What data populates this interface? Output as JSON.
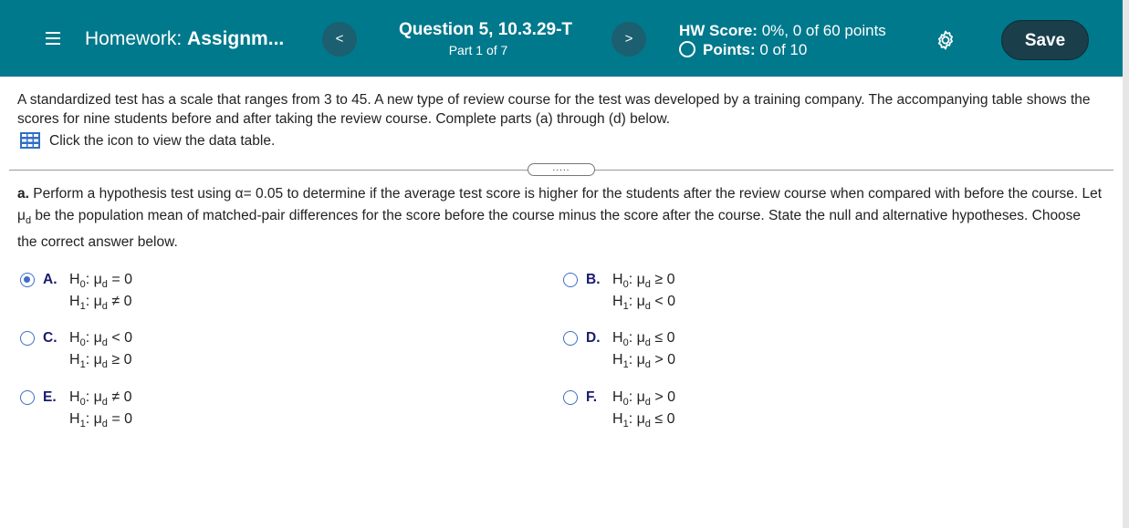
{
  "header": {
    "homework_prefix": "Homework:",
    "homework_name": "Assignm...",
    "prev_label": "<",
    "next_label": ">",
    "question_title": "Question 5, 10.3.29-T",
    "part": "Part 1 of 7",
    "hw_score_label": "HW Score:",
    "hw_score_value": "0%, 0 of 60 points",
    "points_label": "Points:",
    "points_value": "0 of 10",
    "save_label": "Save"
  },
  "intro": {
    "text": "A standardized test has a scale that ranges from 3 to 45. A new type of review course for the test was developed by a training company. The accompanying table shows the scores for nine students before and after taking the review course. Complete parts (a) through (d) below.",
    "table_link": "Click the icon to view the data table."
  },
  "divider": {
    "dots": "....."
  },
  "question": {
    "part_label": "a.",
    "text_1": "Perform a hypothesis test using",
    "alpha": "α",
    "alpha_value": "= 0.05",
    "text_2": "to determine if the average test score is higher for the students after the review course when compared with before the course. Let",
    "mu": "μ",
    "mu_sub": "d",
    "text_3": "be the population mean of matched-pair differences for the score before the course minus the score after the course. State the null and alternative hypotheses. Choose the correct answer below."
  },
  "options": [
    {
      "letter": "A.",
      "h0": "H",
      "h0_sub": "0",
      "h0_rel": ": μ",
      "h0_mu_sub": "d",
      "h0_tail": " = 0",
      "h1": "H",
      "h1_sub": "1",
      "h1_rel": ": μ",
      "h1_mu_sub": "d",
      "h1_tail": " ≠ 0",
      "selected": true
    },
    {
      "letter": "B.",
      "h0": "H",
      "h0_sub": "0",
      "h0_rel": ": μ",
      "h0_mu_sub": "d",
      "h0_tail": " ≥ 0",
      "h1": "H",
      "h1_sub": "1",
      "h1_rel": ": μ",
      "h1_mu_sub": "d",
      "h1_tail": " < 0",
      "selected": false
    },
    {
      "letter": "C.",
      "h0": "H",
      "h0_sub": "0",
      "h0_rel": ": μ",
      "h0_mu_sub": "d",
      "h0_tail": " < 0",
      "h1": "H",
      "h1_sub": "1",
      "h1_rel": ": μ",
      "h1_mu_sub": "d",
      "h1_tail": " ≥ 0",
      "selected": false
    },
    {
      "letter": "D.",
      "h0": "H",
      "h0_sub": "0",
      "h0_rel": ": μ",
      "h0_mu_sub": "d",
      "h0_tail": " ≤ 0",
      "h1": "H",
      "h1_sub": "1",
      "h1_rel": ": μ",
      "h1_mu_sub": "d",
      "h1_tail": " > 0",
      "selected": false
    },
    {
      "letter": "E.",
      "h0": "H",
      "h0_sub": "0",
      "h0_rel": ": μ",
      "h0_mu_sub": "d",
      "h0_tail": " ≠ 0",
      "h1": "H",
      "h1_sub": "1",
      "h1_rel": ": μ",
      "h1_mu_sub": "d",
      "h1_tail": " = 0",
      "selected": false
    },
    {
      "letter": "F.",
      "h0": "H",
      "h0_sub": "0",
      "h0_rel": ": μ",
      "h0_mu_sub": "d",
      "h0_tail": " > 0",
      "h1": "H",
      "h1_sub": "1",
      "h1_rel": ": μ",
      "h1_mu_sub": "d",
      "h1_tail": " ≤ 0",
      "selected": false
    }
  ],
  "icons": {
    "menu": "hamburger-menu-icon",
    "settings": "gear-icon",
    "table": "data-table-icon",
    "points_indicator": "empty-circle-icon"
  },
  "colors": {
    "header_bg": "#00798c",
    "save_bg": "#1a3f4a",
    "nav_btn_bg": "#1b5f70",
    "radio": "#3d6ec6",
    "option_letter": "#1a1a6e"
  }
}
